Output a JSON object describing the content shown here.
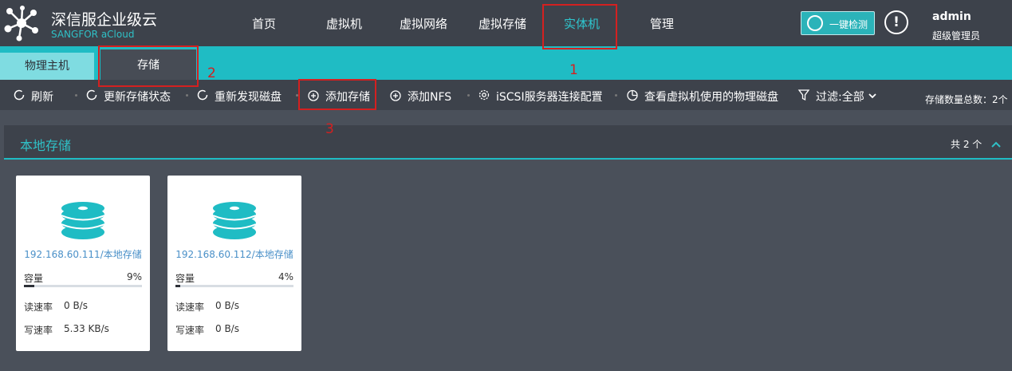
{
  "brand": {
    "name_cn": "深信服企业级云",
    "name_en": "SANGFOR aCloud"
  },
  "nav": [
    {
      "label": "首页"
    },
    {
      "label": "虚拟机"
    },
    {
      "label": "虚拟网络"
    },
    {
      "label": "虚拟存储"
    },
    {
      "label": "实体机",
      "active": true
    },
    {
      "label": "管理"
    }
  ],
  "header": {
    "check_button": "一键检测",
    "alert_icon": "!",
    "user": {
      "name": "admin",
      "role": "超级管理员"
    }
  },
  "tabs": [
    {
      "label": "物理主机"
    },
    {
      "label": "存储",
      "active": true
    }
  ],
  "toolbar": {
    "items": [
      {
        "label": "刷新",
        "icon": "refresh-icon"
      },
      {
        "label": "更新存储状态",
        "icon": "refresh-icon"
      },
      {
        "label": "重新发现磁盘",
        "icon": "refresh-icon"
      },
      {
        "label": "添加存储",
        "icon": "plus-circle-icon"
      },
      {
        "label": "添加NFS",
        "icon": "plus-circle-icon"
      },
      {
        "label": "iSCSI服务器连接配置",
        "icon": "gear-icon"
      },
      {
        "label": "查看虚拟机使用的物理磁盘",
        "icon": "pie-icon"
      },
      {
        "label": "过滤:全部",
        "icon": "filter-icon"
      }
    ],
    "total": "存储数量总数：2个"
  },
  "section": {
    "title": "本地存储",
    "count": "共 2 个"
  },
  "cards": [
    {
      "name": "192.168.60.111/本地存储",
      "capacity_label": "容量",
      "capacity_pct": "9%",
      "capacity_fraction": 0.09,
      "read_label": "读速率",
      "read_value": "0 B/s",
      "write_label": "写速率",
      "write_value": "5.33 KB/s"
    },
    {
      "name": "192.168.60.112/本地存储",
      "capacity_label": "容量",
      "capacity_pct": "4%",
      "capacity_fraction": 0.04,
      "read_label": "读速率",
      "read_value": "0 B/s",
      "write_label": "写速率",
      "write_value": "0 B/s"
    }
  ],
  "annotations": {
    "step1": "1",
    "step2": "2",
    "step3": "3"
  },
  "colors": {
    "accent": "#1fbcc4",
    "topbar": "#3d424b",
    "background": "#4a505a",
    "annotation": "#d42020"
  }
}
